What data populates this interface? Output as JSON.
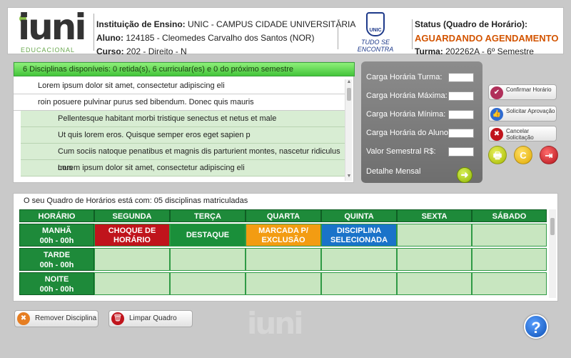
{
  "header": {
    "logo_text": "iuni",
    "logo_sub": "EDUCACIONAL",
    "instituicao_label": "Instituição de Ensino:",
    "instituicao_value": "UNIC - CAMPUS CIDADE UNIVERSITÁRIA",
    "aluno_label": "Aluno:",
    "aluno_value": "124185 - Cleomedes Carvalho dos Santos (NOR)",
    "curso_label": "Curso:",
    "curso_value": "202 - Direito - N",
    "unic_logo": "UNIC",
    "unic_slogan": "TUDO SE ENCONTRA",
    "status_label": "Status (Quadro de Horário):",
    "status_value": "AGUARDANDO AGENDAMENTO",
    "turma_label": "Turma:",
    "turma_value": "202262A - 6º Semestre"
  },
  "disciplinas": {
    "summary": "6 Disciplinas disponíveis: 0 retida(s), 6 curricular(es) e 0 do próximo semestre",
    "items": [
      {
        "text": "Lorem ipsum dolor sit amet, consectetur adipiscing eli"
      },
      {
        "text": "roin posuere pulvinar purus sed bibendum. Donec quis mauris"
      },
      {
        "text": "Pellentesque habitant morbi tristique senectus et netus et male"
      },
      {
        "text": "Ut quis lorem eros. Quisque semper eros eget sapien p"
      },
      {
        "text": "Cum sociis natoque penatibus et magnis dis parturient montes, nascetur ridiculus mus"
      },
      {
        "text": "Lorem ipsum dolor sit amet, consectetur adipiscing eli"
      }
    ]
  },
  "carga": {
    "turma_label": "Carga Horária Turma:",
    "maxima_label": "Carga Horária Máxima:",
    "minima_label": "Carga Horária Mínima:",
    "aluno_label": "Carga Horária do Aluno:",
    "valor_label": "Valor Semestral R$:",
    "detalhe_label": "Detalhe Mensal"
  },
  "actions": {
    "confirmar": "Confirmar Horário",
    "solicitar": "Solicitar Aprovação",
    "cancelar": "Cancelar Solicitação"
  },
  "schedule": {
    "title": "O seu Quadro de Horários está com: 05 disciplinas matriculadas",
    "headers": [
      "HORÁRIO",
      "SEGUNDA",
      "TERÇA",
      "QUARTA",
      "QUINTA",
      "SEXTA",
      "SÁBADO"
    ],
    "rows": [
      {
        "period": "MANHÃ",
        "time": "00h - 00h"
      },
      {
        "period": "TARDE",
        "time": "00h - 00h"
      },
      {
        "period": "NOITE",
        "time": "00h - 00h"
      }
    ],
    "cells": {
      "choque_line1": "CHOQUE DE",
      "choque_line2": "HORÁRIO",
      "destaque": "DESTAQUE",
      "marcada_line1": "MARCADA P/",
      "marcada_line2": "EXCLUSÃO",
      "selecionada_line1": "DISCIPLINA",
      "selecionada_line2": "SELECIONADA"
    }
  },
  "bottom": {
    "remover": "Remover Disciplina",
    "limpar": "Limpar Quadro",
    "watermark": "iuni"
  },
  "colors": {
    "accent_green": "#1e8a3a",
    "status_orange": "#d35400",
    "choque_red": "#c0141c",
    "marcada_orange": "#f39c12",
    "selecionada_blue": "#1a73c9"
  }
}
